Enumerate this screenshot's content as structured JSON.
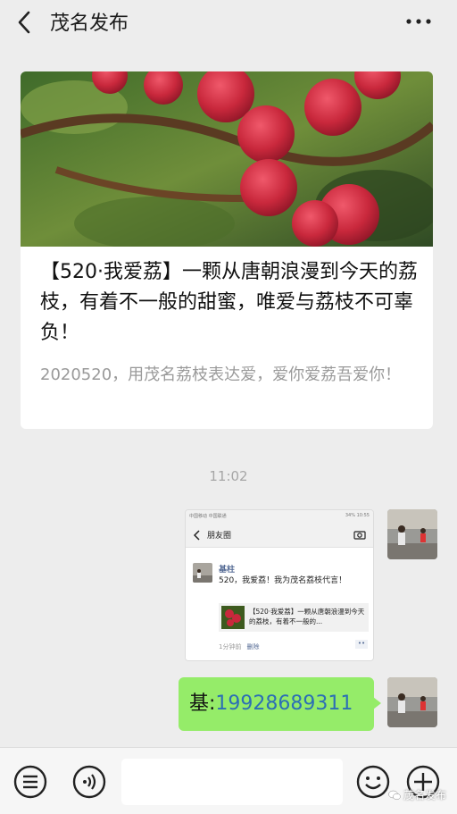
{
  "header": {
    "title": "茂名发布"
  },
  "article": {
    "title": "【520·我爱荔】一颗从唐朝浪漫到今天的荔枝，有着不一般的甜蜜，唯爱与荔枝不可辜负！",
    "description": "2020520，用茂名荔枝表达爱，爱你爱荔吾爱你！"
  },
  "chat": {
    "timestamp": "11:02",
    "screenshot": {
      "status_left": "中国移动 中国联通",
      "status_right": "34% 10:55",
      "nav_title": "朋友圈",
      "poster_name": "基柱",
      "post_text": "520，我爱荔！我为茂名荔枝代言！",
      "link_title": "【520·我爱荔】一颗从唐朝浪漫到今天的荔枝，有着不一般的...",
      "time_ago": "1分钟前",
      "delete_label": "删除"
    },
    "bubble": {
      "prefix": "基:",
      "number": "19928689311"
    }
  },
  "watermark": {
    "text": "茂名发布"
  },
  "colors": {
    "bubble": "#95ec69",
    "background": "#ededed",
    "link": "#2c6fb5"
  }
}
